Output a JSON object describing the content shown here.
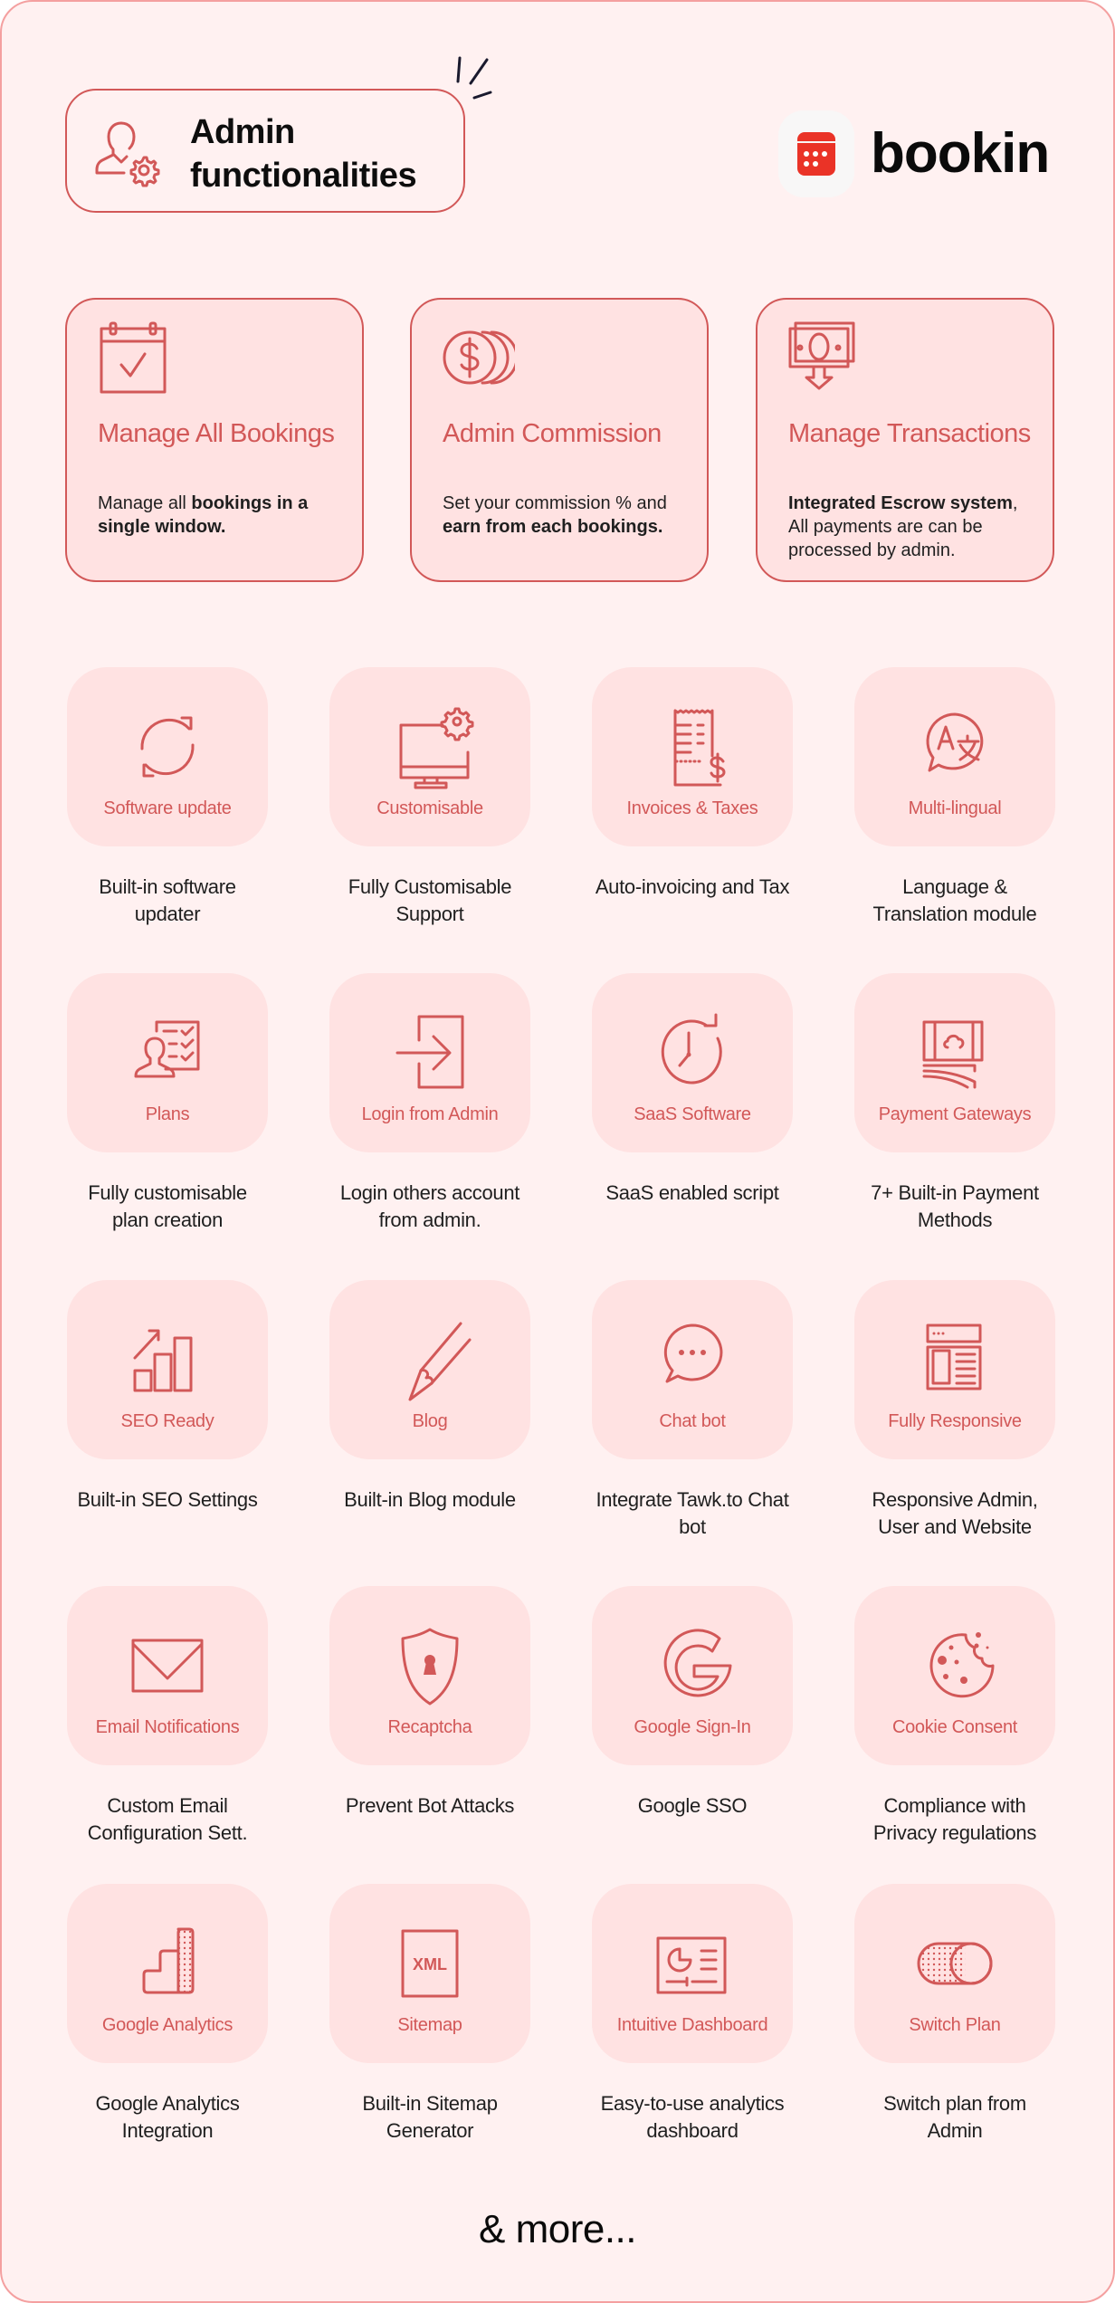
{
  "header": {
    "title_line1": "Admin",
    "title_line2": "functionalities",
    "title_icon": "admin-gear-icon",
    "brand": "bookin",
    "brand_icon": "calendar-icon"
  },
  "colors": {
    "accent": "#d25858",
    "tile_bg": "#ffe2e2",
    "page_bg": "#fff1f1",
    "frame_border": "#f4a0a0",
    "logo_red": "#ea3327"
  },
  "highlights": [
    {
      "icon": "calendar-check-icon",
      "title": "Manage All Bookings",
      "desc_parts": [
        {
          "text": "Manage all ",
          "bold": false
        },
        {
          "text": "bookings in a single window.",
          "bold": true
        }
      ]
    },
    {
      "icon": "coins-dollar-icon",
      "title": "Admin Commission",
      "desc_parts": [
        {
          "text": "Set your commission  % and ",
          "bold": false
        },
        {
          "text": "earn from each bookings.",
          "bold": true
        }
      ]
    },
    {
      "icon": "money-transfer-icon",
      "title": "Manage Transactions",
      "desc_parts": [
        {
          "text": "Integrated Escrow system",
          "bold": true
        },
        {
          "text": ", All payments are can be processed by admin.",
          "bold": false
        }
      ]
    }
  ],
  "features": [
    {
      "icon": "refresh-icon",
      "label": "Software update",
      "desc": "Built-in software updater"
    },
    {
      "icon": "monitor-gear-icon",
      "label": "Customisable",
      "desc": "Fully Customisable Support"
    },
    {
      "icon": "invoice-dollar-icon",
      "label": "Invoices & Taxes",
      "desc": "Auto-invoicing and Tax"
    },
    {
      "icon": "translate-bubble-icon",
      "label": "Multi-lingual",
      "desc": "Language & Translation module"
    },
    {
      "icon": "user-checklist-icon",
      "label": "Plans",
      "desc": "Fully customisable plan creation"
    },
    {
      "icon": "login-icon",
      "label": "Login from Admin",
      "desc": "Login others account from admin."
    },
    {
      "icon": "clock-refresh-icon",
      "label": "SaaS Software",
      "desc": "SaaS enabled script"
    },
    {
      "icon": "payment-cards-icon",
      "label": "Payment Gateways",
      "desc": "7+ Built-in Payment Methods"
    },
    {
      "icon": "bar-chart-growth-icon",
      "label": "SEO Ready",
      "desc": "Built-in SEO Settings"
    },
    {
      "icon": "pencil-icon",
      "label": "Blog",
      "desc": "Built-in Blog module"
    },
    {
      "icon": "chat-bubble-icon",
      "label": "Chat bot",
      "desc": "Integrate Tawk.to Chat bot"
    },
    {
      "icon": "responsive-layout-icon",
      "label": "Fully Responsive",
      "desc": "Responsive Admin, User and Website"
    },
    {
      "icon": "envelope-icon",
      "label": "Email Notifications",
      "desc": "Custom Email Configuration Sett."
    },
    {
      "icon": "shield-keyhole-icon",
      "label": "Recaptcha",
      "desc": "Prevent Bot Attacks"
    },
    {
      "icon": "google-g-icon",
      "label": "Google Sign-In",
      "desc": "Google SSO"
    },
    {
      "icon": "cookie-icon",
      "label": "Cookie Consent",
      "desc": "Compliance with Privacy regulations"
    },
    {
      "icon": "google-analytics-icon",
      "label": "Google Analytics",
      "desc": "Google Analytics Integration"
    },
    {
      "icon": "xml-file-icon",
      "label": "Sitemap",
      "desc": "Built-in Sitemap Generator"
    },
    {
      "icon": "dashboard-chart-icon",
      "label": "Intuitive Dashboard",
      "desc": "Easy-to-use analytics dashboard"
    },
    {
      "icon": "toggle-switch-icon",
      "label": "Switch Plan",
      "desc": "Switch plan from Admin"
    }
  ],
  "xml_icon_text": "XML",
  "footer": {
    "more": "& more..."
  }
}
